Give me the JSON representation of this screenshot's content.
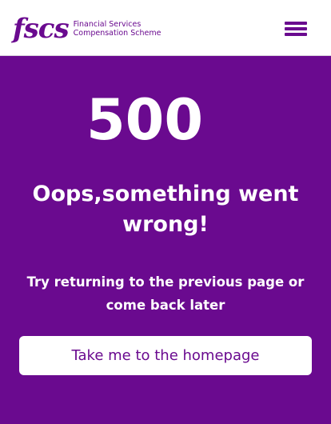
{
  "header": {
    "logo_mark": "fscs",
    "logo_line1": "Financial Services",
    "logo_line2": "Compensation Scheme",
    "menu_icon": "hamburger-menu-icon"
  },
  "error": {
    "code": "500",
    "title": "Oops,something went wrong!",
    "message": "Try returning to the previous page or come back later",
    "home_button_label": "Take me to the homepage"
  },
  "colors": {
    "brand_purple": "#6a0a8f",
    "white": "#ffffff"
  }
}
